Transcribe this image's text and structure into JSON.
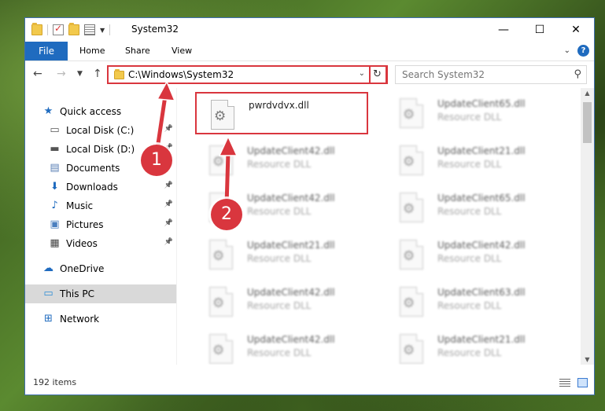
{
  "window": {
    "title": "System32",
    "controls": {
      "minimize": "—",
      "maximize": "☐",
      "close": "✕"
    }
  },
  "ribbon": {
    "file_label": "File",
    "tabs": [
      "Home",
      "Share",
      "View"
    ],
    "help_icon": "?"
  },
  "address_bar": {
    "path": "C:\\Windows\\System32",
    "search_placeholder": "Search System32"
  },
  "sidebar": {
    "items": [
      {
        "label": "Quick access",
        "icon": "star-icon",
        "glyph": "★",
        "color": "#1f6bbf",
        "pinned": false
      },
      {
        "label": "Local Disk (C:)",
        "icon": "drive-icon",
        "glyph": "▭",
        "color": "#555555",
        "pinned": true
      },
      {
        "label": "Local Disk (D:)",
        "icon": "drive-icon",
        "glyph": "▬",
        "color": "#555555",
        "pinned": true
      },
      {
        "label": "Documents",
        "icon": "document-icon",
        "glyph": "▤",
        "color": "#5a7fb5",
        "pinned": true
      },
      {
        "label": "Downloads",
        "icon": "download-icon",
        "glyph": "⬇",
        "color": "#1f6bbf",
        "pinned": true
      },
      {
        "label": "Music",
        "icon": "music-icon",
        "glyph": "♪",
        "color": "#1f6bbf",
        "pinned": true
      },
      {
        "label": "Pictures",
        "icon": "picture-icon",
        "glyph": "▣",
        "color": "#4a7fbf",
        "pinned": true
      },
      {
        "label": "Videos",
        "icon": "video-icon",
        "glyph": "▦",
        "color": "#444444",
        "pinned": true
      },
      {
        "label": "OneDrive",
        "icon": "cloud-icon",
        "glyph": "☁",
        "color": "#1f6bbf",
        "pinned": false
      },
      {
        "label": "This PC",
        "icon": "computer-icon",
        "glyph": "▭",
        "color": "#2a8bd6",
        "pinned": false,
        "selected": true
      },
      {
        "label": "Network",
        "icon": "network-icon",
        "glyph": "⊞",
        "color": "#1f6bbf",
        "pinned": false
      }
    ]
  },
  "files": [
    {
      "name": "pwrdvdvx.dll",
      "type": "",
      "highlighted": true
    },
    {
      "name": "UpdateClient65.dll",
      "type": "Resource DLL"
    },
    {
      "name": "UpdateClient42.dll",
      "type": "Resource DLL"
    },
    {
      "name": "UpdateClient21.dll",
      "type": "Resource DLL"
    },
    {
      "name": "UpdateClient42.dll",
      "type": "Resource DLL"
    },
    {
      "name": "UpdateClient65.dll",
      "type": "Resource DLL"
    },
    {
      "name": "UpdateClient21.dll",
      "type": "Resource DLL"
    },
    {
      "name": "UpdateClient42.dll",
      "type": "Resource DLL"
    },
    {
      "name": "UpdateClient42.dll",
      "type": "Resource DLL"
    },
    {
      "name": "UpdateClient63.dll",
      "type": "Resource DLL"
    },
    {
      "name": "UpdateClient42.dll",
      "type": "Resource DLL"
    },
    {
      "name": "UpdateClient21.dll",
      "type": "Resource DLL"
    }
  ],
  "status": {
    "item_count": "192 items"
  },
  "annotations": {
    "step1": "1",
    "step2": "2",
    "accent_color": "#d9363e"
  }
}
